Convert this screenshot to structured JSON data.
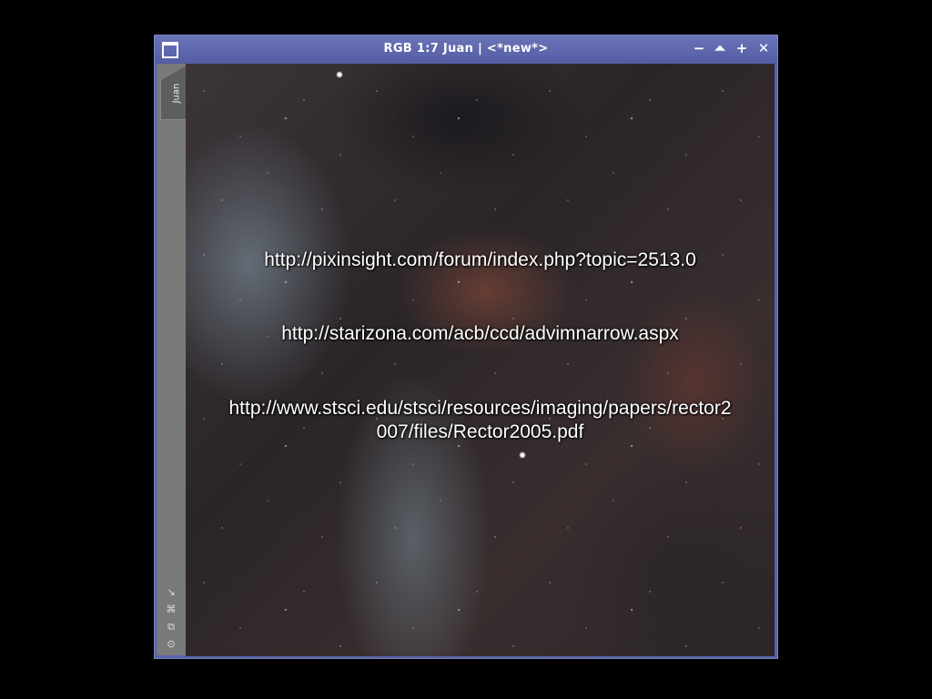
{
  "window": {
    "title": "RGB 1:7 Juan | <*new*>",
    "icons": {
      "window": "window-icon",
      "minimize": "minimize-icon",
      "shade": "shade-icon",
      "maximize": "maximize-icon",
      "close": "close-icon"
    },
    "glyphs": {
      "minimize": "−",
      "shade": "⏶",
      "maximize": "+",
      "close": "✕"
    }
  },
  "sidebar": {
    "tab_label": "Juan",
    "icons": [
      {
        "name": "fit-view-icon",
        "glyph": "↘"
      },
      {
        "name": "zoom-fit-icon",
        "glyph": "⌘"
      },
      {
        "name": "clone-icon",
        "glyph": "⧉"
      },
      {
        "name": "target-icon",
        "glyph": "⊙"
      }
    ]
  },
  "image": {
    "lines": [
      "http://pixinsight.com/forum/index.php?topic=2513.0",
      "http://starizona.com/acb/ccd/advimnarrow.aspx",
      "http://www.stsci.edu/stsci/resources/imaging/papers/rector2",
      "007/files/Rector2005.pdf"
    ]
  }
}
